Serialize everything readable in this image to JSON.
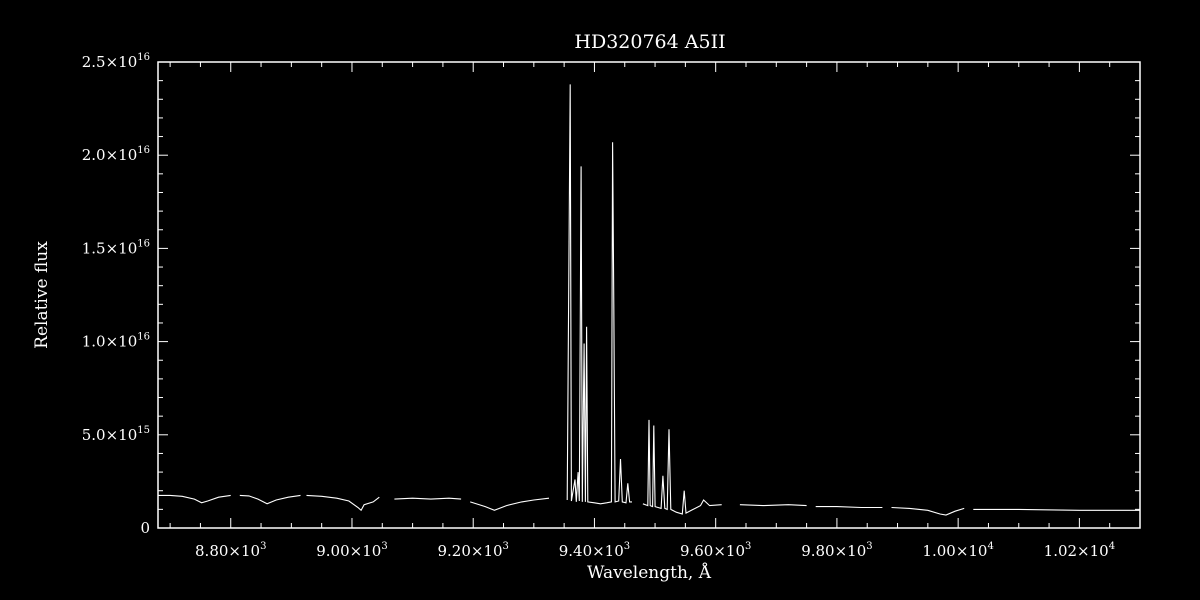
{
  "chart_data": {
    "type": "line",
    "title": "HD320764   A5II",
    "xlabel": "Wavelength, Å",
    "ylabel": "Relative flux",
    "xlim": [
      8680,
      10300
    ],
    "ylim": [
      0,
      2.5e+16
    ],
    "x_ticks": [
      {
        "value": 8800,
        "mant": "8.80",
        "exp": "3"
      },
      {
        "value": 9000,
        "mant": "9.00",
        "exp": "3"
      },
      {
        "value": 9200,
        "mant": "9.20",
        "exp": "3"
      },
      {
        "value": 9400,
        "mant": "9.40",
        "exp": "3"
      },
      {
        "value": 9600,
        "mant": "9.60",
        "exp": "3"
      },
      {
        "value": 9800,
        "mant": "9.80",
        "exp": "3"
      },
      {
        "value": 10000,
        "mant": "1.00",
        "exp": "4"
      },
      {
        "value": 10200,
        "mant": "1.02",
        "exp": "4"
      }
    ],
    "y_ticks": [
      {
        "value": 0,
        "mant": "0",
        "exp": ""
      },
      {
        "value": 5000000000000000.0,
        "mant": "5.0",
        "exp": "15"
      },
      {
        "value": 1e+16,
        "mant": "1.0",
        "exp": "16"
      },
      {
        "value": 1.5e+16,
        "mant": "1.5",
        "exp": "16"
      },
      {
        "value": 2e+16,
        "mant": "2.0",
        "exp": "16"
      },
      {
        "value": 2.5e+16,
        "mant": "2.5",
        "exp": "16"
      }
    ],
    "grid": false,
    "line_color": "#ffffff",
    "background": "#000000",
    "series": [
      {
        "values": [
          [
            8680,
            1750000000000000.0
          ],
          [
            8700,
            1750000000000000.0
          ],
          [
            8720,
            1700000000000000.0
          ],
          [
            8740,
            1550000000000000.0
          ],
          [
            8752,
            1350000000000000.0
          ],
          [
            8762,
            1450000000000000.0
          ],
          [
            8780,
            1650000000000000.0
          ],
          [
            8800,
            1750000000000000.0
          ]
        ]
      },
      {
        "values": [
          [
            8815,
            1750000000000000.0
          ],
          [
            8830,
            1720000000000000.0
          ],
          [
            8845,
            1550000000000000.0
          ],
          [
            8860,
            1300000000000000.0
          ],
          [
            8875,
            1500000000000000.0
          ],
          [
            8895,
            1650000000000000.0
          ],
          [
            8915,
            1750000000000000.0
          ]
        ]
      },
      {
        "values": [
          [
            8925,
            1750000000000000.0
          ],
          [
            8950,
            1700000000000000.0
          ],
          [
            8975,
            1600000000000000.0
          ],
          [
            8995,
            1450000000000000.0
          ],
          [
            9010,
            1100000000000000.0
          ],
          [
            9015,
            950000000000000.0
          ],
          [
            9020,
            1250000000000000.0
          ],
          [
            9035,
            1400000000000000.0
          ],
          [
            9045,
            1650000000000000.0
          ]
        ]
      },
      {
        "values": [
          [
            9070,
            1550000000000000.0
          ],
          [
            9100,
            1600000000000000.0
          ],
          [
            9130,
            1550000000000000.0
          ],
          [
            9160,
            1600000000000000.0
          ],
          [
            9180,
            1550000000000000.0
          ]
        ]
      },
      {
        "values": [
          [
            9195,
            1400000000000000.0
          ],
          [
            9220,
            1150000000000000.0
          ],
          [
            9235,
            950000000000000.0
          ],
          [
            9255,
            1200000000000000.0
          ],
          [
            9280,
            1400000000000000.0
          ],
          [
            9300,
            1500000000000000.0
          ],
          [
            9325,
            1600000000000000.0
          ]
        ]
      },
      {
        "values": [
          [
            9355,
            1500000000000000.0
          ],
          [
            9360,
            2.38e+16
          ],
          [
            9362,
            1450000000000000.0
          ],
          [
            9368,
            2600000000000000.0
          ],
          [
            9370,
            1400000000000000.0
          ],
          [
            9373,
            3000000000000000.0
          ],
          [
            9375,
            1450000000000000.0
          ],
          [
            9378,
            1.94e+16
          ],
          [
            9380,
            1400000000000000.0
          ],
          [
            9383,
            9900000000000000.0
          ],
          [
            9385,
            1400000000000000.0
          ],
          [
            9387,
            1.08e+16
          ],
          [
            9389,
            1400000000000000.0
          ],
          [
            9400,
            1350000000000000.0
          ],
          [
            9410,
            1300000000000000.0
          ],
          [
            9420,
            1350000000000000.0
          ],
          [
            9428,
            1400000000000000.0
          ],
          [
            9430,
            2.07e+16
          ],
          [
            9432,
            1.2e+16
          ],
          [
            9434,
            1400000000000000.0
          ],
          [
            9440,
            1450000000000000.0
          ],
          [
            9443,
            3700000000000000.0
          ],
          [
            9446,
            1400000000000000.0
          ],
          [
            9452,
            1350000000000000.0
          ],
          [
            9455,
            2400000000000000.0
          ],
          [
            9458,
            1400000000000000.0
          ],
          [
            9462,
            1400000000000000.0
          ]
        ]
      },
      {
        "values": [
          [
            9480,
            1300000000000000.0
          ],
          [
            9488,
            1200000000000000.0
          ],
          [
            9490,
            5800000000000000.0
          ],
          [
            9492,
            1200000000000000.0
          ],
          [
            9496,
            1150000000000000.0
          ],
          [
            9498,
            5500000000000000.0
          ],
          [
            9500,
            1150000000000000.0
          ],
          [
            9505,
            1100000000000000.0
          ],
          [
            9510,
            1050000000000000.0
          ],
          [
            9513,
            2800000000000000.0
          ],
          [
            9516,
            1050000000000000.0
          ],
          [
            9520,
            1000000000000000.0
          ],
          [
            9523,
            5300000000000000.0
          ],
          [
            9526,
            1000000000000000.0
          ],
          [
            9535,
            850000000000000.0
          ],
          [
            9545,
            750000000000000.0
          ],
          [
            9548,
            2000000000000000.0
          ],
          [
            9551,
            800000000000000.0
          ],
          [
            9560,
            950000000000000.0
          ],
          [
            9575,
            1200000000000000.0
          ],
          [
            9580,
            1500000000000000.0
          ],
          [
            9590,
            1200000000000000.0
          ],
          [
            9610,
            1250000000000000.0
          ]
        ]
      },
      {
        "values": [
          [
            9640,
            1250000000000000.0
          ],
          [
            9680,
            1200000000000000.0
          ],
          [
            9720,
            1250000000000000.0
          ],
          [
            9750,
            1200000000000000.0
          ]
        ]
      },
      {
        "values": [
          [
            9765,
            1150000000000000.0
          ],
          [
            9800,
            1150000000000000.0
          ],
          [
            9840,
            1100000000000000.0
          ],
          [
            9875,
            1100000000000000.0
          ]
        ]
      },
      {
        "values": [
          [
            9890,
            1100000000000000.0
          ],
          [
            9920,
            1050000000000000.0
          ],
          [
            9950,
            950000000000000.0
          ],
          [
            9970,
            750000000000000.0
          ],
          [
            9980,
            700000000000000.0
          ],
          [
            9995,
            900000000000000.0
          ],
          [
            10010,
            1050000000000000.0
          ]
        ]
      },
      {
        "values": [
          [
            10025,
            1000000000000000.0
          ],
          [
            10100,
            1000000000000000.0
          ],
          [
            10200,
            950000000000000.0
          ],
          [
            10300,
            950000000000000.0
          ]
        ]
      }
    ]
  }
}
